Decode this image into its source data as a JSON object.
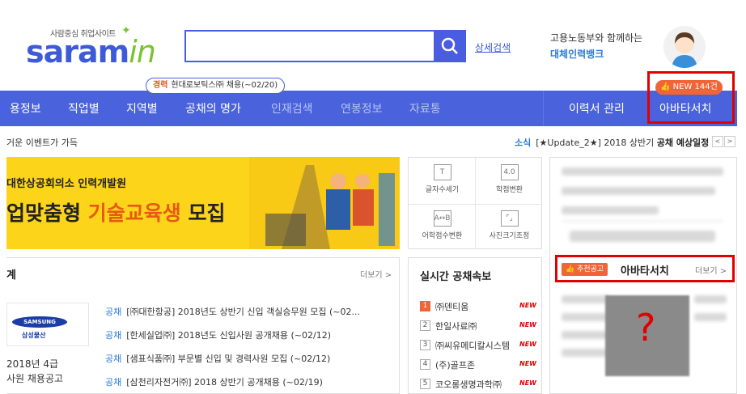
{
  "header": {
    "logo_sub": "사람중심 취업사이트",
    "logo_main": "saram",
    "logo_in": "in",
    "advanced_search": "상세검색",
    "partner_line1": "고용노동부와 함께하는",
    "partner_line2": "대체인력뱅크"
  },
  "tooltip": {
    "tag": "경력",
    "text": "현대로보틱스㈜ 채용(~02/20)"
  },
  "nav": {
    "items": [
      "용정보",
      "직업별",
      "지역별",
      "공채의 명가",
      "인재검색",
      "연봉정보",
      "자료통"
    ],
    "resume": "이력서 관리",
    "avatar_search": "아바타서치",
    "new_badge": "NEW 144건"
  },
  "event_bar": {
    "left_text": "거운 이벤트가 가득",
    "news_tag": "소식",
    "news_text": "[★Update_2★] 2018 상반기 ",
    "news_highlight": "공채 예상일정",
    "prev": "<",
    "next": ">"
  },
  "banner": {
    "sub": "대한상공회의소 인력개발원",
    "main_prefix": "업맞춤형 ",
    "main_highlight": "기술교육생",
    "main_suffix": " 모집"
  },
  "tools": [
    {
      "label": "글자수세기",
      "icon": "T"
    },
    {
      "label": "학점변환",
      "icon": "4.0"
    },
    {
      "label": "어학점수변환",
      "icon": "A↔B"
    },
    {
      "label": "사진크기조정",
      "icon": "⌜⌟"
    }
  ],
  "section_left": {
    "title": "계",
    "more": "더보기 >",
    "logo_text": "SAMSUNG",
    "logo_sub": "삼성물산",
    "announcement_line1": "2018년 4급",
    "announcement_line2": "사원 채용공고",
    "jobs": [
      {
        "tag": "공채",
        "text": "[㈜대한항공] 2018년도 상반기 신입 객실승무원 모집 (~02..."
      },
      {
        "tag": "공채",
        "text": "[한세실업㈜] 2018년도 신입사원 공개채용 (~02/12)"
      },
      {
        "tag": "공채",
        "text": "[샘표식품㈜] 부문별 신입 및 경력사원 모집 (~02/12)"
      },
      {
        "tag": "공채",
        "text": "[삼천리자전거㈜] 2018 상반기 공개채용 (~02/19)"
      }
    ]
  },
  "realtime": {
    "title": "실시간 공채속보",
    "rows": [
      {
        "num": "1",
        "name": "㈜덴티움",
        "new": "NEW"
      },
      {
        "num": "2",
        "name": "한일사료㈜",
        "new": "NEW"
      },
      {
        "num": "3",
        "name": "㈜씨유메디칼시스템",
        "new": "NEW"
      },
      {
        "num": "4",
        "name": "(주)골프존",
        "new": "NEW"
      },
      {
        "num": "5",
        "name": "코오롱생명과학㈜",
        "new": "NEW"
      }
    ]
  },
  "right_panel": {
    "rec_badge": "추천공고",
    "title": "아바타서치",
    "more": "더보기 >",
    "question": "?"
  },
  "colors": {
    "brand": "#3d5bd8",
    "nav": "#4a63dc",
    "highlight_border": "#e10000",
    "accent": "#f06535"
  }
}
